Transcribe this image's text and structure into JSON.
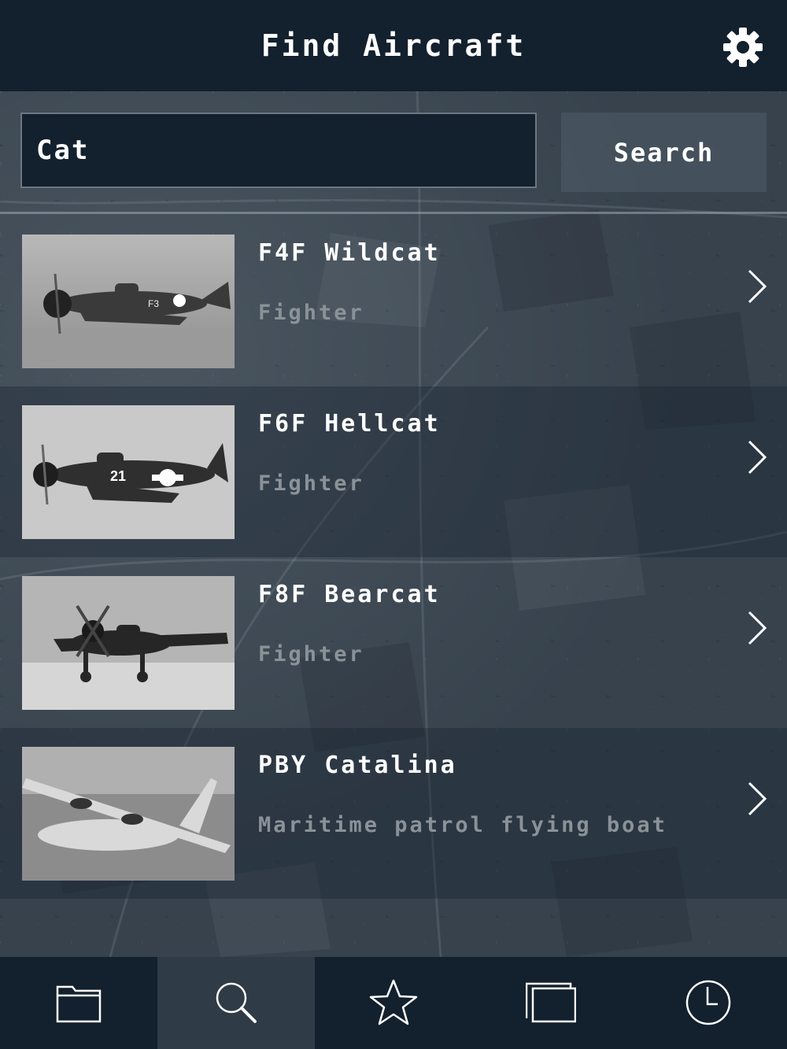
{
  "header": {
    "title": "Find Aircraft",
    "settings_icon": "gear-icon"
  },
  "search": {
    "value": "Cat",
    "button_label": "Search"
  },
  "results": [
    {
      "title": "F4F Wildcat",
      "subtitle": "Fighter",
      "thumbnail": "wildcat-photo"
    },
    {
      "title": "F6F Hellcat",
      "subtitle": "Fighter",
      "thumbnail": "hellcat-photo"
    },
    {
      "title": "F8F Bearcat",
      "subtitle": "Fighter",
      "thumbnail": "bearcat-photo"
    },
    {
      "title": "PBY Catalina",
      "subtitle": "Maritime patrol flying boat",
      "thumbnail": "catalina-photo"
    }
  ],
  "tabbar": {
    "tabs": [
      {
        "icon": "folder-icon",
        "active": false
      },
      {
        "icon": "search-icon",
        "active": true
      },
      {
        "icon": "star-icon",
        "active": false
      },
      {
        "icon": "windows-icon",
        "active": false
      },
      {
        "icon": "clock-icon",
        "active": false
      }
    ]
  },
  "colors": {
    "header_bg": "#13202e",
    "tabbar_bg": "#13202e",
    "active_tab_bg": "#2f3b47",
    "subtitle_text": "#8a9298"
  }
}
